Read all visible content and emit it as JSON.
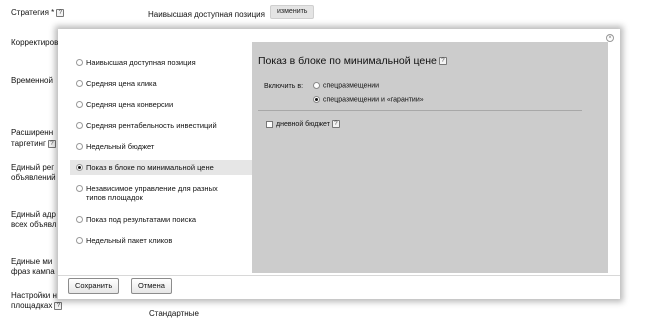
{
  "background": {
    "strategy_label": "Стратегия *",
    "strategy_value": "Наивысшая доступная позиция",
    "change_button": "изменить",
    "labels": [
      "Корректиров",
      "Временной",
      "Расширенн",
      "таргетинг",
      "Единый рег",
      "объявлений",
      "Единый адр",
      "всех объявл",
      "Единые ми",
      "фраз кампа",
      "Настройки н",
      "площадках"
    ],
    "bottom_value": "Стандартные"
  },
  "modal": {
    "close_icon": "×",
    "help_icon": "?",
    "strategies": [
      "Наивысшая доступная позиция",
      "Средняя цена клика",
      "Средняя цена конверсии",
      "Средняя рентабельность инвестиций",
      "Недельный бюджет",
      "Показ в блоке по минимальной цене",
      "Независимое управление для разных",
      "типов площадок",
      "Показ под результатами поиска",
      "Недельный пакет кликов"
    ],
    "panel": {
      "title": "Показ в блоке по минимальной цене",
      "include_label": "Включить в:",
      "option_1": "спецразмещении",
      "option_2": "спецразмещении и «гарантии»",
      "weekly_budget": "дневной бюджет"
    },
    "save_button": "Сохранить",
    "cancel_button": "Отмена"
  }
}
